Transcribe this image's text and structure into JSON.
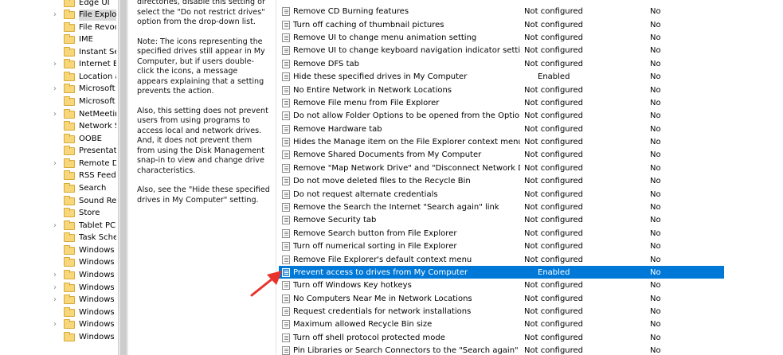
{
  "tree": {
    "items": [
      {
        "label": "Edge UI",
        "chevron": false
      },
      {
        "label": "File Explorer",
        "chevron": true,
        "selected": true
      },
      {
        "label": "File Revocation",
        "chevron": false
      },
      {
        "label": "IME",
        "chevron": false
      },
      {
        "label": "Instant Search",
        "chevron": false
      },
      {
        "label": "Internet Explorer",
        "chevron": true
      },
      {
        "label": "Location and Sensors",
        "chevron": false
      },
      {
        "label": "Microsoft Edge",
        "chevron": true
      },
      {
        "label": "Microsoft",
        "chevron": false
      },
      {
        "label": "NetMeeting",
        "chevron": true
      },
      {
        "label": "Network Sharing",
        "chevron": false
      },
      {
        "label": "OOBE",
        "chevron": false
      },
      {
        "label": "Presentation Settings",
        "chevron": false
      },
      {
        "label": "Remote Desktop",
        "chevron": true
      },
      {
        "label": "RSS Feeds",
        "chevron": false
      },
      {
        "label": "Search",
        "chevron": false
      },
      {
        "label": "Sound Recorder",
        "chevron": false
      },
      {
        "label": "Store",
        "chevron": false
      },
      {
        "label": "Tablet PC",
        "chevron": true
      },
      {
        "label": "Task Scheduler",
        "chevron": false
      },
      {
        "label": "Windows Calendar",
        "chevron": false
      },
      {
        "label": "Windows Color System",
        "chevron": false
      },
      {
        "label": "Windows Customer",
        "chevron": true
      },
      {
        "label": "Windows Defender",
        "chevron": true
      },
      {
        "label": "Windows Error",
        "chevron": true
      },
      {
        "label": "Windows Hello",
        "chevron": false
      },
      {
        "label": "Windows Ink",
        "chevron": true
      },
      {
        "label": "Windows Installer",
        "chevron": false
      }
    ]
  },
  "description": {
    "paragraphs": [
      "directories, disable this setting or select the \"Do not restrict drives\" option from the drop-down list.",
      "Note: The icons representing the specified drives still appear in My Computer, but if users double-click the icons, a message appears explaining that a setting prevents the action.",
      "Also, this setting does not prevent users from using programs to access local and network drives. And, it does not prevent them from using the Disk Management snap-in to view and change drive characteristics.",
      "Also, see the \"Hide these specified drives in My Computer\" setting."
    ]
  },
  "settings": {
    "rows": [
      {
        "name": "Remove CD Burning features",
        "state": "Not configured",
        "comment": "No"
      },
      {
        "name": "Turn off caching of thumbnail pictures",
        "state": "Not configured",
        "comment": "No"
      },
      {
        "name": "Remove UI to change menu animation setting",
        "state": "Not configured",
        "comment": "No"
      },
      {
        "name": "Remove UI to change keyboard navigation indicator setting",
        "state": "Not configured",
        "comment": "No"
      },
      {
        "name": "Remove DFS tab",
        "state": "Not configured",
        "comment": "No"
      },
      {
        "name": "Hide these specified drives in My Computer",
        "state": "Enabled",
        "comment": "No"
      },
      {
        "name": "No Entire Network in Network Locations",
        "state": "Not configured",
        "comment": "No"
      },
      {
        "name": "Remove File menu from File Explorer",
        "state": "Not configured",
        "comment": "No"
      },
      {
        "name": "Do not allow Folder Options to be opened from the Options...",
        "state": "Not configured",
        "comment": "No"
      },
      {
        "name": "Remove Hardware tab",
        "state": "Not configured",
        "comment": "No"
      },
      {
        "name": "Hides the Manage item on the File Explorer context menu",
        "state": "Not configured",
        "comment": "No"
      },
      {
        "name": "Remove Shared Documents from My Computer",
        "state": "Not configured",
        "comment": "No"
      },
      {
        "name": "Remove \"Map Network Drive\" and \"Disconnect Network Dri...",
        "state": "Not configured",
        "comment": "No"
      },
      {
        "name": "Do not move deleted files to the Recycle Bin",
        "state": "Not configured",
        "comment": "No"
      },
      {
        "name": "Do not request alternate credentials",
        "state": "Not configured",
        "comment": "No"
      },
      {
        "name": "Remove the Search the Internet \"Search again\" link",
        "state": "Not configured",
        "comment": "No"
      },
      {
        "name": "Remove Security tab",
        "state": "Not configured",
        "comment": "No"
      },
      {
        "name": "Remove Search button from File Explorer",
        "state": "Not configured",
        "comment": "No"
      },
      {
        "name": "Turn off numerical sorting in File Explorer",
        "state": "Not configured",
        "comment": "No"
      },
      {
        "name": "Remove File Explorer's default context menu",
        "state": "Not configured",
        "comment": "No"
      },
      {
        "name": "Prevent access to drives from My Computer",
        "state": "Enabled",
        "comment": "No",
        "selected": true
      },
      {
        "name": "Turn off Windows Key hotkeys",
        "state": "Not configured",
        "comment": "No"
      },
      {
        "name": "No Computers Near Me in Network Locations",
        "state": "Not configured",
        "comment": "No"
      },
      {
        "name": "Request credentials for network installations",
        "state": "Not configured",
        "comment": "No"
      },
      {
        "name": "Maximum allowed Recycle Bin size",
        "state": "Not configured",
        "comment": "No"
      },
      {
        "name": "Turn off shell protocol protected mode",
        "state": "Not configured",
        "comment": "No"
      },
      {
        "name": "Pin Libraries or Search Connectors to the \"Search again\" link...",
        "state": "Not configured",
        "comment": "No"
      }
    ]
  },
  "colors": {
    "selection": "#0078d7",
    "annotation_arrow": "#e8322b"
  },
  "icons": {
    "tree_item": "folder-icon",
    "setting": "policy-setting-icon",
    "expand": "chevron-right-icon"
  }
}
